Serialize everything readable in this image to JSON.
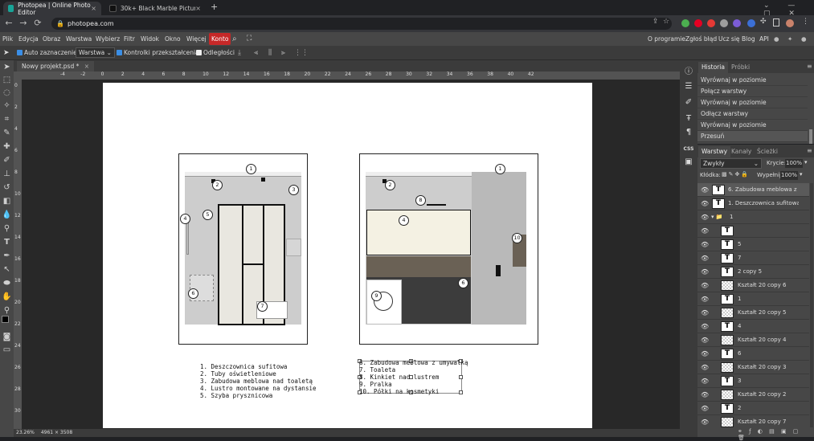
{
  "browser": {
    "tabs": [
      {
        "title": "Photopea | Online Photo Editor",
        "favicon_color": "#18a497",
        "active": true
      },
      {
        "title": "30k+ Black Marble Pictures | Dow",
        "favicon_color": "#111111",
        "active": false
      }
    ],
    "new_tab": "+",
    "url": "photopea.com"
  },
  "menu": {
    "items": [
      "Plik",
      "Edycja",
      "Obraz",
      "Warstwa",
      "Wybierz",
      "Filtr",
      "Widok",
      "Okno",
      "Więcej"
    ],
    "account": "Konto",
    "right_links": [
      "O programie",
      "Zgłoś błąd",
      "Ucz się",
      "Blog",
      "API"
    ]
  },
  "options": {
    "auto_select": "Auto zaznaczenie",
    "auto_select_target": "Warstwa",
    "transform_controls": "Kontrolki przekształcenia",
    "distances": "Odległości"
  },
  "document": {
    "tab_title": "Nowy projekt.psd *",
    "zoom": "23.26%",
    "size": "4961 × 3508"
  },
  "ruler": {
    "h_labels": [
      "-4",
      "-2",
      "0",
      "2",
      "4",
      "6",
      "8",
      "10",
      "12",
      "14",
      "16",
      "18",
      "20",
      "22",
      "24",
      "26",
      "28",
      "30",
      "32",
      "34",
      "36",
      "38",
      "40",
      "42"
    ],
    "v_labels": [
      "0",
      "2",
      "4",
      "6",
      "8",
      "10",
      "12",
      "14",
      "16",
      "18",
      "20",
      "22",
      "24",
      "26",
      "28",
      "30"
    ]
  },
  "drawing": {
    "left_markers": [
      "1",
      "2",
      "3",
      "4",
      "5",
      "6",
      "7"
    ],
    "right_markers": [
      "1",
      "2",
      "8",
      "4",
      "10",
      "6",
      "9"
    ],
    "legend_left": [
      "1. Deszczownica sufitowa",
      "2. Tuby oświetleniowe",
      "3. Zabudowa meblowa nad toaletą",
      "4. Lustro montowane na dystansie",
      "5. Szyba prysznicowa"
    ],
    "legend_right": [
      "6. Zabudowa meblowa z umywalką",
      "7. Toaleta",
      "8. Kinkiet nad lustrem",
      "9. Pralka",
      "10. Półki na kosmetyki"
    ]
  },
  "history": {
    "tabs": [
      "Historia",
      "Próbki"
    ],
    "items": [
      "Wyrównaj w poziomie",
      "Połącz warstwy",
      "Wyrównaj w poziomie",
      "Odłącz warstwy",
      "Wyrównaj w poziomie",
      "Przesuń"
    ]
  },
  "layers": {
    "tabs": [
      "Warstwy",
      "Kanały",
      "Ścieżki"
    ],
    "blend_mode": "Zwykły",
    "opacity_label": "Krycie:",
    "opacity": "100%",
    "lock_label": "Kłódka:",
    "fill_label": "Wypełnij:",
    "fill": "100%",
    "items": [
      {
        "name": "6. Zabudowa meblowa z",
        "type": "text",
        "selected": true
      },
      {
        "name": "1. Deszczownica sufitowa",
        "type": "text"
      },
      {
        "name": "1",
        "type": "group"
      },
      {
        "name": "",
        "type": "text"
      },
      {
        "name": "5",
        "type": "text"
      },
      {
        "name": "7",
        "type": "text"
      },
      {
        "name": "2 copy 5",
        "type": "text"
      },
      {
        "name": "Kształt 20 copy 6",
        "type": "shape"
      },
      {
        "name": "1",
        "type": "text"
      },
      {
        "name": "Kształt 20 copy 5",
        "type": "shape"
      },
      {
        "name": "4",
        "type": "text"
      },
      {
        "name": "Kształt 20 copy 4",
        "type": "shape"
      },
      {
        "name": "6",
        "type": "text"
      },
      {
        "name": "Kształt 20 copy 3",
        "type": "shape"
      },
      {
        "name": "3",
        "type": "text"
      },
      {
        "name": "Kształt 20 copy 2",
        "type": "shape"
      },
      {
        "name": "2",
        "type": "text"
      },
      {
        "name": "Kształt 20 copy 7",
        "type": "shape"
      }
    ]
  },
  "icons": {
    "thumb_text_glyph": "T",
    "eye_glyph": "👁",
    "folder_glyph": "▾ 📁"
  }
}
